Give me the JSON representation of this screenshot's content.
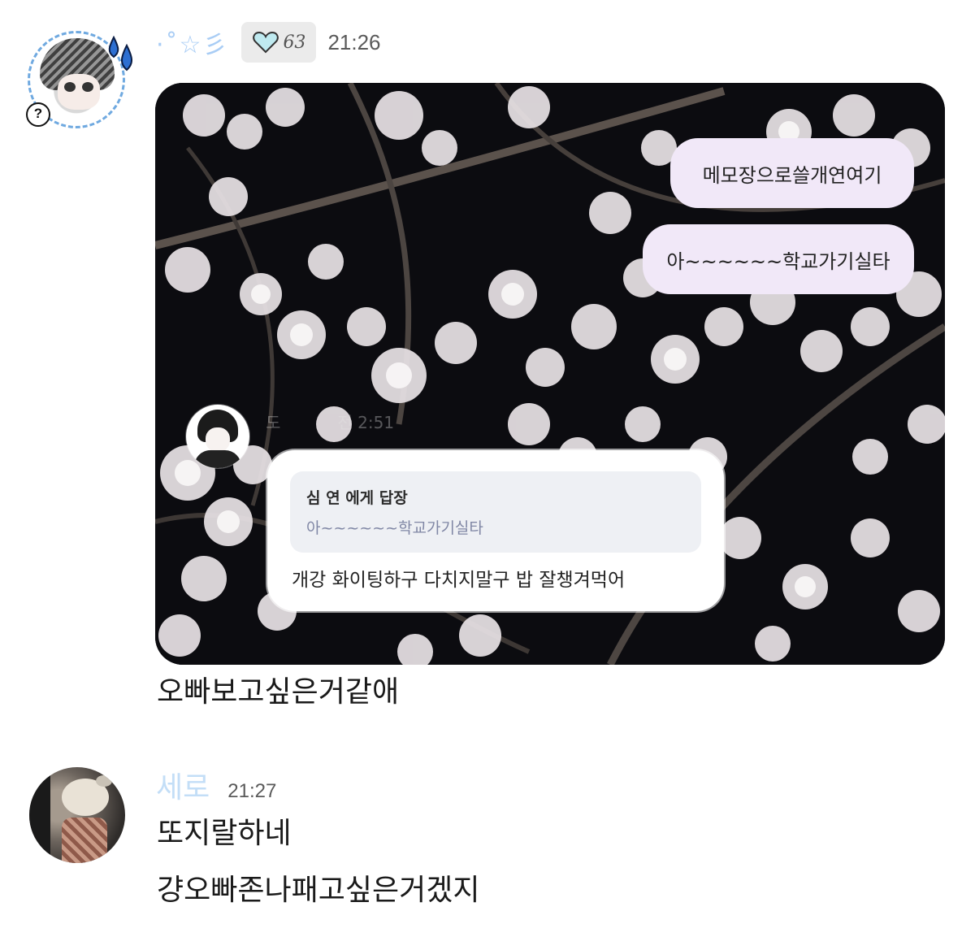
{
  "message1": {
    "author_decoration": "·˚☆彡",
    "badge_number": "63",
    "time": "21:26",
    "embedded_screenshot": {
      "outgoing_bubbles": [
        "메모장으로쓸개연여기",
        "아~~~~~~학교가기실타"
      ],
      "reply_author_meta": "도",
      "reply_time_meta": "전 2:51",
      "reply_to_label": "심 연 에게 답장",
      "reply_quoted_text": "아~~~~~~학교가기실타",
      "reply_text": "개강 화이팅하구 다치지말구 밥 잘챙겨먹어"
    },
    "text": "오빠보고싶은거같애",
    "badge_icon": "heart-icon",
    "avatar_badge": "?"
  },
  "message2": {
    "author": "세로",
    "time": "21:27",
    "lines": [
      "또지랄하네",
      "걍오빠존나패고싶은거겠지"
    ]
  },
  "colors": {
    "name_blue": "#c3def7",
    "bubble_lavender": "#f1e8f8",
    "badge_bg": "#ebebeb",
    "reply_quote_bg": "#eef0f4",
    "quoted_text": "#8087a5"
  }
}
